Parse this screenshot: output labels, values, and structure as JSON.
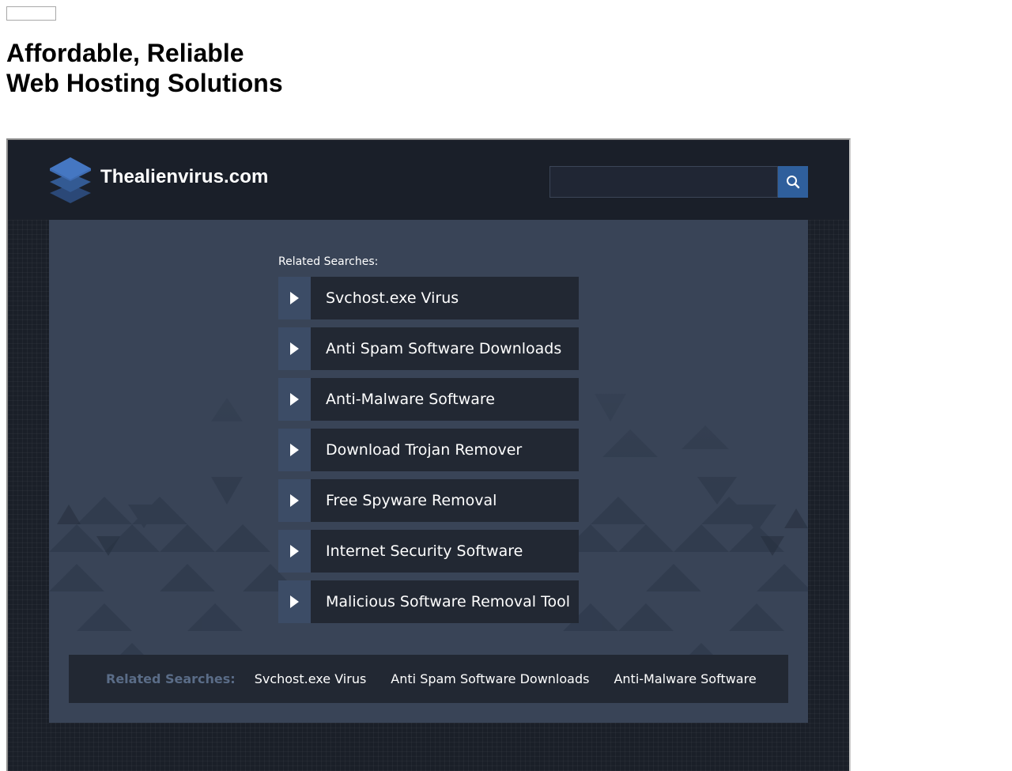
{
  "page": {
    "top_button_label": "",
    "hosting_title_line1": "Affordable, Reliable",
    "hosting_title_line2": "Web Hosting Solutions"
  },
  "parked_site": {
    "site_name": "Thealienvirus.com",
    "logo_icon": "layered-stack-icon",
    "search": {
      "value": "",
      "placeholder": "",
      "button_icon": "search-icon"
    },
    "related_searches_label": "Related Searches:",
    "links": [
      {
        "label": "Svchost.exe Virus",
        "icon": "play-arrow-icon"
      },
      {
        "label": "Anti Spam Software Downloads",
        "icon": "play-arrow-icon"
      },
      {
        "label": "Anti-Malware Software",
        "icon": "play-arrow-icon"
      },
      {
        "label": "Download Trojan Remover",
        "icon": "play-arrow-icon"
      },
      {
        "label": "Free Spyware Removal",
        "icon": "play-arrow-icon"
      },
      {
        "label": "Internet Security Software",
        "icon": "play-arrow-icon"
      },
      {
        "label": "Malicious Software Removal Tool",
        "icon": "play-arrow-icon"
      }
    ],
    "footer": {
      "label": "Related Searches:",
      "links": [
        "Svchost.exe Virus",
        "Anti Spam Software Downloads",
        "Anti-Malware Software"
      ]
    }
  },
  "colors": {
    "header_background": "#1a1f29",
    "panel_background": "#394457",
    "link_background": "#222833",
    "arrow_box": "#3c4c66",
    "search_button": "#2f5f9c",
    "footer_label": "#5a6c87",
    "text": "#ffffff"
  }
}
